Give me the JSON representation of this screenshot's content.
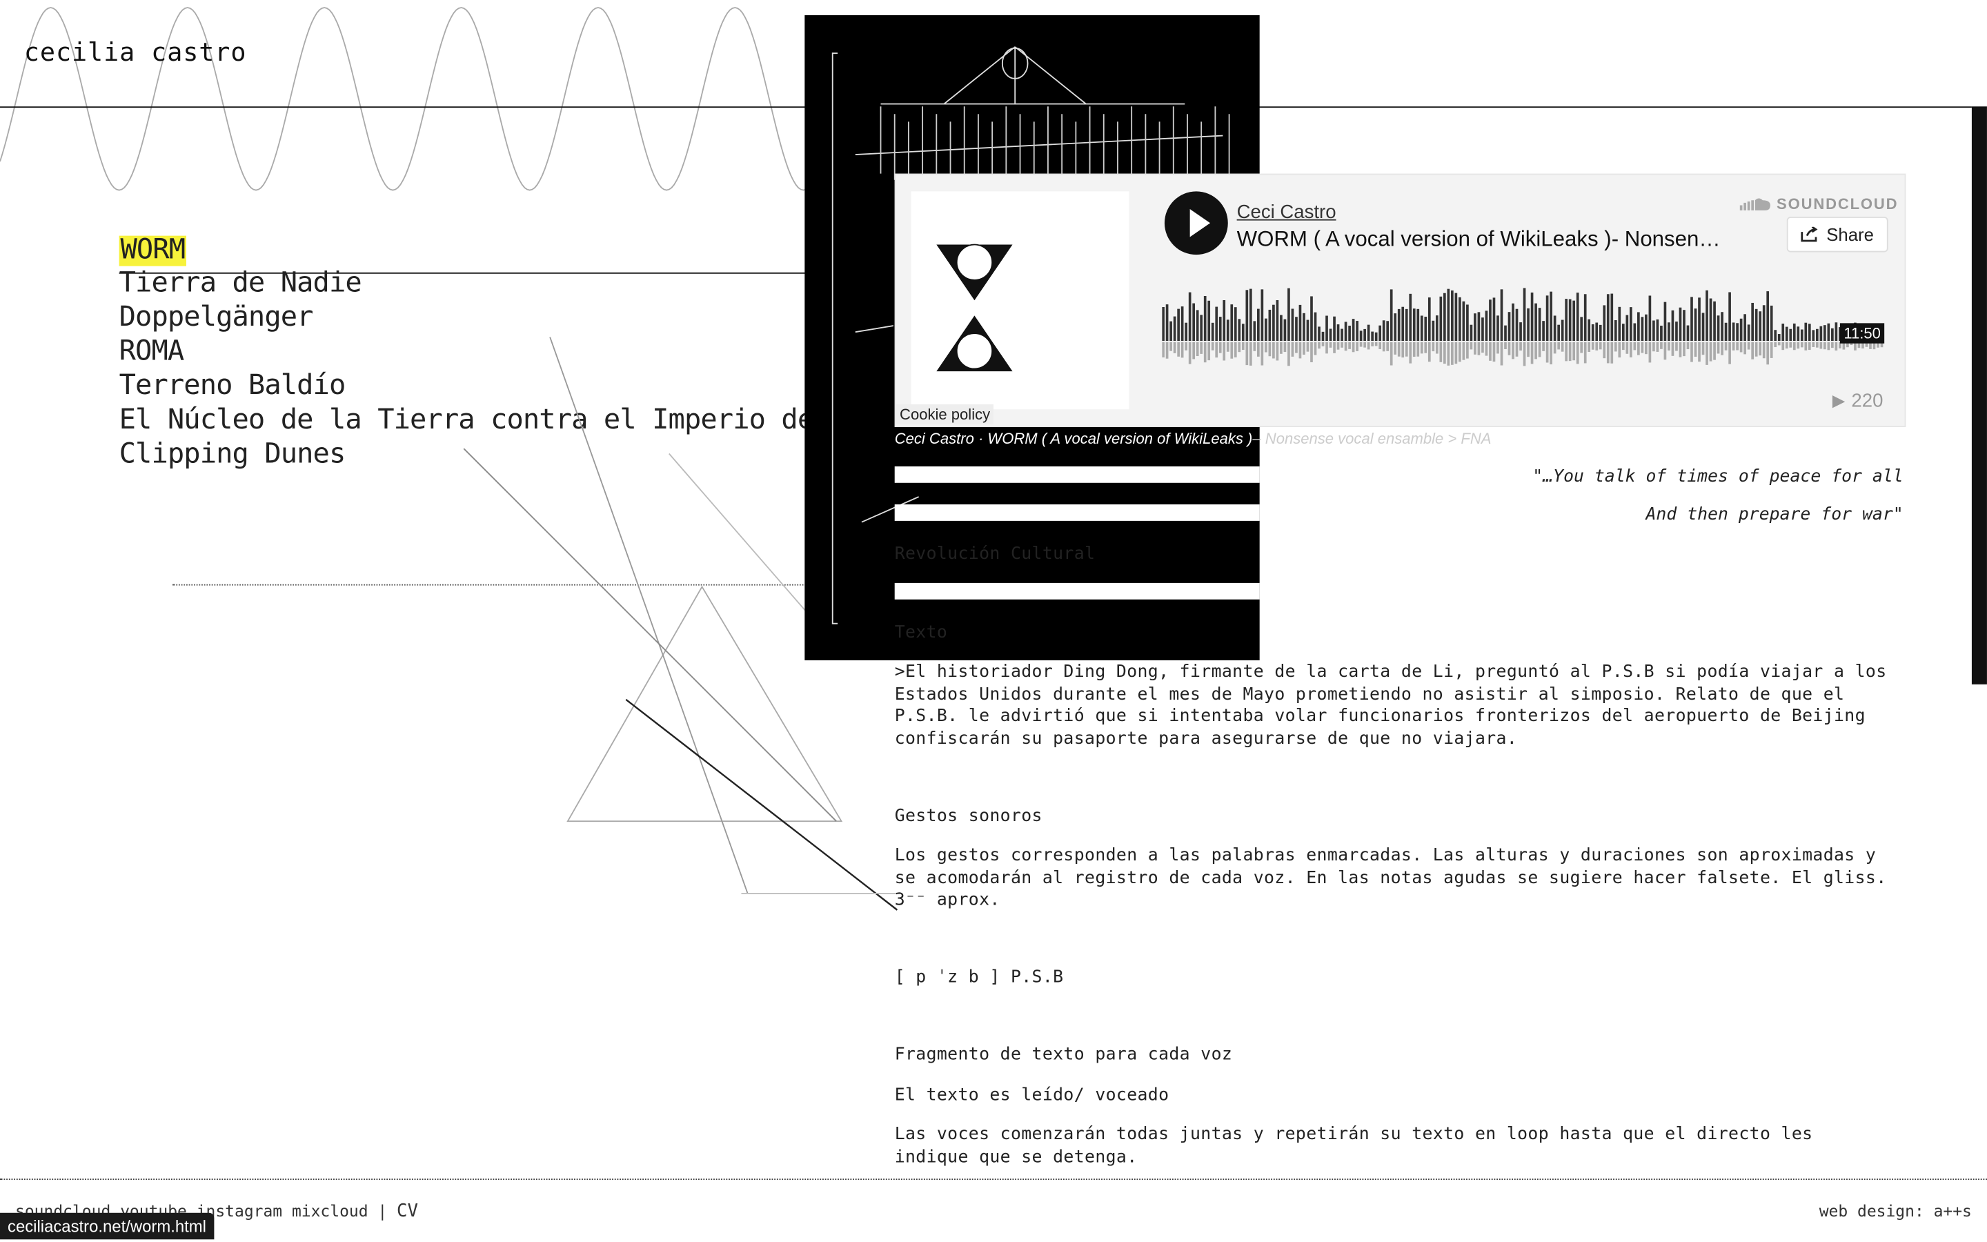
{
  "site": {
    "title": "cecilia castro"
  },
  "nav": {
    "items": [
      {
        "label": "WORM",
        "active": true
      },
      {
        "label": "Tierra de Nadie"
      },
      {
        "label": "Doppelgänger"
      },
      {
        "label": "ROMA"
      },
      {
        "label": "Terreno Baldío"
      },
      {
        "label": "El Núcleo de la Tierra contra el Imperio del So"
      },
      {
        "label": "Clipping Dunes"
      }
    ]
  },
  "player": {
    "artist": "Ceci Castro",
    "track": "WORM ( A vocal version of WikiLeaks )- Nonsense vocal ensamble > FNA",
    "brand": "SOUNDCLOUD",
    "share_label": "Share",
    "duration": "11:50",
    "plays": "220",
    "cookie_label": "Cookie policy",
    "caption_link": "Ceci Castro · WORM ( A vocal version of WikiLeaks )",
    "caption_rest": "– Nonsense vocal ensamble > FNA",
    "accent": "#111111",
    "icons": [
      "play-icon",
      "soundcloud-cloud-icon",
      "share-icon",
      "plays-icon"
    ]
  },
  "quote": {
    "line1": "\"…You talk of times of peace for all",
    "line2": "And then prepare for war\""
  },
  "content": {
    "heading1": "Revolución Cultural",
    "heading2": "Texto",
    "para1": ">El historiador Ding Dong, firmante de la carta de Li, preguntó al P.S.B si podía viajar a los Estados Unidos durante el mes de Mayo prometiendo no asistir al simposio. Relato de que el P.S.B. le advirtió que si intentaba volar funcionarios fronterizos del aeropuerto de Beijing confiscarán su pasaporte para asegurarse de que no viajara.",
    "heading3": "Gestos sonoros",
    "para2": "Los gestos corresponden a las palabras enmarcadas. Las alturas y duraciones son aproximadas y se acomodarán al registro de cada voz. En las notas agudas se sugiere hacer falsete. El gliss. 3⁻⁻ aprox.",
    "phonetic": "[ p ˈz b ] P.S.B",
    "heading4": "Fragmento de texto para cada voz",
    "para3": "El texto es leído/ voceado",
    "para4": "Las voces comenzarán todas juntas y repetirán su texto en loop hasta que el directo les indique que se detenga."
  },
  "footer": {
    "links": [
      "soundcloud",
      "youtube",
      "instagram",
      "mixcloud"
    ],
    "separator": "|",
    "cv": "CV",
    "credit": "web design: a++s"
  },
  "status_bar": {
    "url": "ceciliacastro.net/worm.html"
  }
}
